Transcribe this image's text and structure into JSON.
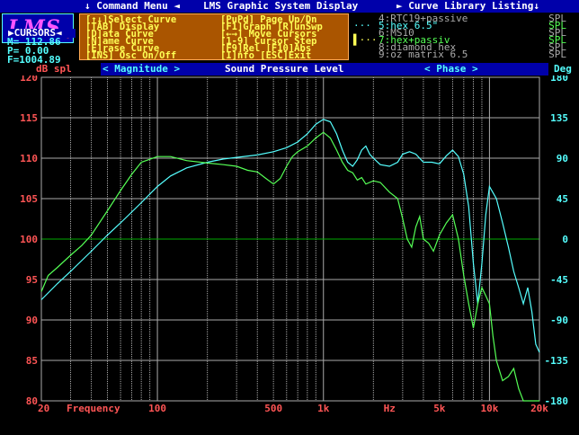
{
  "top_bar": {
    "command_menu": "↓ Command Menu ◄",
    "title": "LMS Graphic System Display",
    "library": "► Curve Library Listing↓"
  },
  "logo": {
    "text": "LMS",
    "mark": "®"
  },
  "cursors": {
    "header": "▶CURSORS◄",
    "m": "M=  112.86",
    "p": "P=    0.00",
    "f": "F=1004.89"
  },
  "menu": {
    "left": [
      "[↑↓]Select Curve",
      "[TAB] Display",
      "[D]ata  Curve",
      "[N]ame  Curve",
      "[E]rase Curve",
      "[INS] Osc On/Off"
    ],
    "right": [
      "[PuPd] Page Up/Dn",
      "[F1]Graph [R]unSwp",
      "[←→] Move Cursors",
      "[1-9] Cursor Step",
      "[F9]Rel [F10]Abs",
      "[I]nfo  [ESC]Exit"
    ]
  },
  "library": [
    {
      "marker": "",
      "name": "4:RTC19+passive",
      "type": "SPL",
      "color": "#aaaaaa",
      "type_color": "#aaaaaa"
    },
    {
      "marker": "···",
      "name": "5:hex 6.5\"",
      "type": "SPL",
      "color": "#55ffff",
      "type_color": "#55ff55",
      "marker_color": "#55ffff"
    },
    {
      "marker": "",
      "name": "6:MS10",
      "type": "SPL",
      "color": "#aaaaaa",
      "type_color": "#aaaaaa"
    },
    {
      "marker": "▌···",
      "name": "7:hex+passiv",
      "type": "SPL",
      "color": "#55ff55",
      "type_color": "#55ff55",
      "marker_color": "#ffff55"
    },
    {
      "marker": "",
      "name": "8:diamond hex",
      "type": "SPL",
      "color": "#aaaaaa",
      "type_color": "#aaaaaa"
    },
    {
      "marker": "",
      "name": "9:oz matrix 6.5",
      "type": "SPL",
      "color": "#aaaaaa",
      "type_color": "#aaaaaa"
    }
  ],
  "sub_bar": {
    "left_unit": "dB spl",
    "magnitude": "< Magnitude >",
    "center": "Sound Pressure Level",
    "phase": "< Phase >",
    "right_unit": "Deg"
  },
  "colors": {
    "magnitude_axis": "#ff5555",
    "phase_axis": "#55ffff",
    "grid": "#aaaaaa",
    "zero_line": "#00aa00"
  },
  "chart_data": {
    "type": "line",
    "xlabel": "Frequency",
    "x_scale": "log",
    "xlim": [
      20,
      20000
    ],
    "x_ticks": [
      {
        "value": 20,
        "label": "20"
      },
      {
        "value": 100,
        "label": "100"
      },
      {
        "value": 500,
        "label": "500"
      },
      {
        "value": 1000,
        "label": "1k"
      },
      {
        "value": 2500,
        "label": "Hz"
      },
      {
        "value": 5000,
        "label": "5k"
      },
      {
        "value": 10000,
        "label": "10k"
      },
      {
        "value": 20000,
        "label": "20k"
      }
    ],
    "ylabel_left": "dB spl",
    "ylim_left": [
      80,
      120
    ],
    "y_ticks_left": [
      80,
      85,
      90,
      95,
      100,
      105,
      110,
      115,
      120
    ],
    "ylabel_right": "Deg",
    "ylim_right": [
      -180,
      180
    ],
    "y_ticks_right": [
      -180,
      -135,
      -90,
      -45,
      0,
      45,
      90,
      135,
      180
    ],
    "grid": true,
    "series": [
      {
        "name": "5:hex 6.5\"",
        "color": "#55ffff",
        "points": [
          [
            20,
            92.5
          ],
          [
            25,
            94.5
          ],
          [
            30,
            96
          ],
          [
            40,
            98.5
          ],
          [
            50,
            100.5
          ],
          [
            60,
            102
          ],
          [
            80,
            104.5
          ],
          [
            100,
            106.5
          ],
          [
            120,
            107.8
          ],
          [
            150,
            108.8
          ],
          [
            200,
            109.5
          ],
          [
            250,
            109.9
          ],
          [
            300,
            110.1
          ],
          [
            400,
            110.4
          ],
          [
            500,
            110.8
          ],
          [
            600,
            111.3
          ],
          [
            700,
            112
          ],
          [
            800,
            113
          ],
          [
            900,
            114.2
          ],
          [
            1000,
            114.8
          ],
          [
            1100,
            114.5
          ],
          [
            1200,
            113
          ],
          [
            1300,
            111
          ],
          [
            1400,
            109.5
          ],
          [
            1500,
            109
          ],
          [
            1600,
            109.8
          ],
          [
            1700,
            111
          ],
          [
            1800,
            111.5
          ],
          [
            1900,
            110.5
          ],
          [
            2000,
            110
          ],
          [
            2200,
            109.2
          ],
          [
            2500,
            109
          ],
          [
            2800,
            109.5
          ],
          [
            3000,
            110.5
          ],
          [
            3300,
            110.8
          ],
          [
            3600,
            110.5
          ],
          [
            4000,
            109.5
          ],
          [
            4500,
            109.5
          ],
          [
            5000,
            109.3
          ],
          [
            5500,
            110.3
          ],
          [
            6000,
            111
          ],
          [
            6500,
            110.2
          ],
          [
            7000,
            108
          ],
          [
            7500,
            104
          ],
          [
            8000,
            97
          ],
          [
            8500,
            92
          ],
          [
            9000,
            97
          ],
          [
            9500,
            103
          ],
          [
            10000,
            106.5
          ],
          [
            11000,
            105
          ],
          [
            12000,
            102
          ],
          [
            13000,
            99
          ],
          [
            14000,
            96
          ],
          [
            15000,
            94
          ],
          [
            16000,
            92
          ],
          [
            17000,
            94
          ],
          [
            18000,
            91
          ],
          [
            19000,
            87
          ],
          [
            20000,
            86
          ]
        ]
      },
      {
        "name": "7:hex+passiv",
        "color": "#55ff55",
        "points": [
          [
            20,
            93.5
          ],
          [
            22,
            95.5
          ],
          [
            25,
            96.5
          ],
          [
            30,
            98
          ],
          [
            35,
            99.2
          ],
          [
            40,
            100.5
          ],
          [
            50,
            103.5
          ],
          [
            60,
            106
          ],
          [
            70,
            108
          ],
          [
            80,
            109.5
          ],
          [
            100,
            110.2
          ],
          [
            120,
            110.2
          ],
          [
            150,
            109.7
          ],
          [
            200,
            109.4
          ],
          [
            250,
            109.2
          ],
          [
            300,
            109
          ],
          [
            350,
            108.5
          ],
          [
            400,
            108.3
          ],
          [
            450,
            107.5
          ],
          [
            500,
            106.8
          ],
          [
            550,
            107.5
          ],
          [
            600,
            109
          ],
          [
            650,
            110.2
          ],
          [
            700,
            110.8
          ],
          [
            800,
            111.5
          ],
          [
            900,
            112.5
          ],
          [
            1000,
            113.2
          ],
          [
            1100,
            112.5
          ],
          [
            1200,
            111
          ],
          [
            1300,
            109.5
          ],
          [
            1400,
            108.5
          ],
          [
            1500,
            108.2
          ],
          [
            1600,
            107.3
          ],
          [
            1700,
            107.6
          ],
          [
            1800,
            106.8
          ],
          [
            2000,
            107.2
          ],
          [
            2200,
            107
          ],
          [
            2500,
            105.8
          ],
          [
            2800,
            105
          ],
          [
            3000,
            102.5
          ],
          [
            3200,
            100
          ],
          [
            3400,
            99
          ],
          [
            3600,
            101.5
          ],
          [
            3800,
            102.8
          ],
          [
            4000,
            100
          ],
          [
            4300,
            99.5
          ],
          [
            4600,
            98.5
          ],
          [
            5000,
            100.5
          ],
          [
            5500,
            102
          ],
          [
            6000,
            103
          ],
          [
            6500,
            100
          ],
          [
            7000,
            95.5
          ],
          [
            7500,
            92
          ],
          [
            8000,
            89
          ],
          [
            8500,
            92
          ],
          [
            9000,
            94
          ],
          [
            9500,
            93
          ],
          [
            10000,
            92
          ],
          [
            10500,
            88
          ],
          [
            11000,
            85
          ],
          [
            12000,
            82.5
          ],
          [
            13000,
            83
          ],
          [
            14000,
            84
          ],
          [
            15000,
            81.5
          ],
          [
            16000,
            80
          ],
          [
            20000,
            80
          ]
        ]
      }
    ]
  }
}
